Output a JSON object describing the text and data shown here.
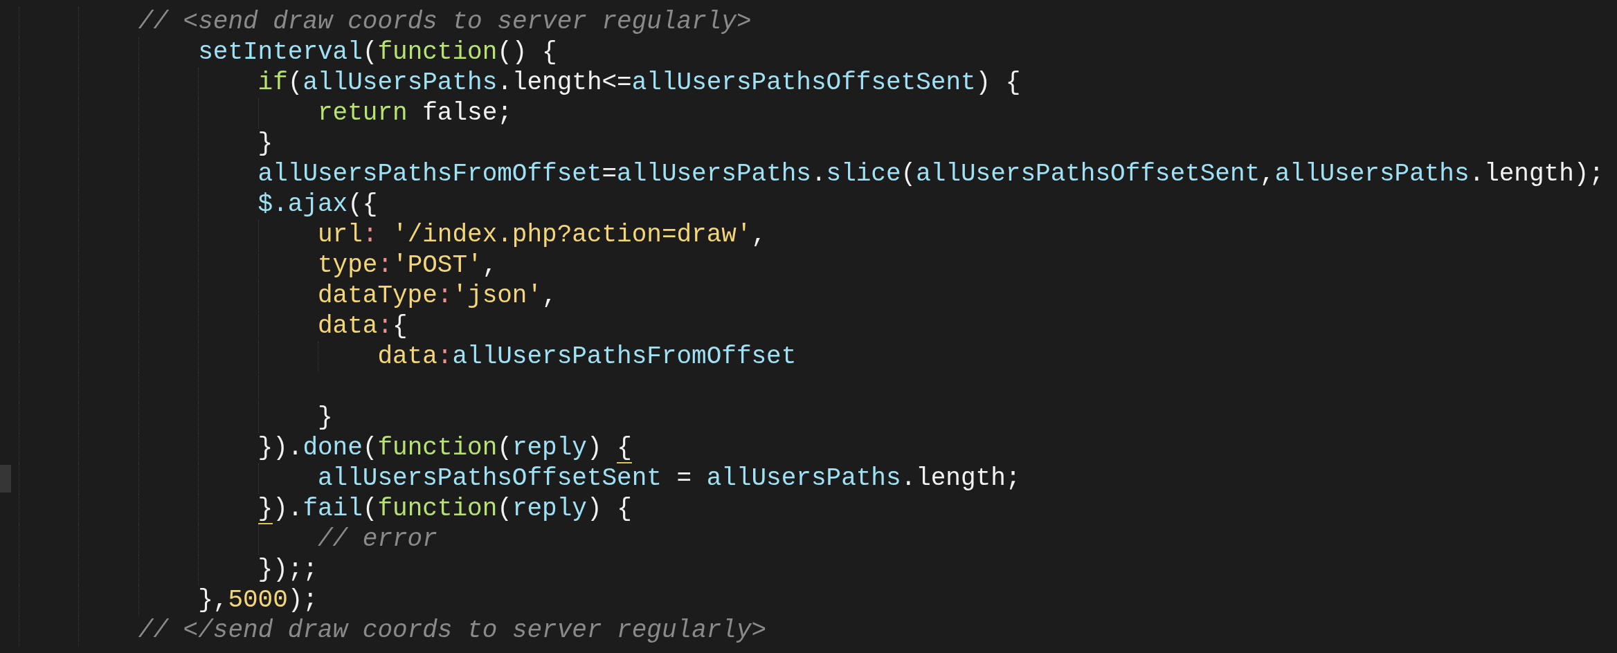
{
  "editor": {
    "lines": [
      {
        "current": false,
        "tokens": [
          {
            "kind": "comment",
            "text": "// <send draw coords to server regularly>",
            "bracket_match": false
          }
        ],
        "children": [
          {
            "current": false,
            "tokens": [
              {
                "kind": "name",
                "text": "setInterval",
                "bracket_match": false
              },
              {
                "kind": "plain",
                "text": "(",
                "bracket_match": false
              },
              {
                "kind": "keyword",
                "text": "function",
                "bracket_match": false
              },
              {
                "kind": "plain",
                "text": "() {",
                "bracket_match": false
              }
            ],
            "children": [
              {
                "current": false,
                "tokens": [
                  {
                    "kind": "keyword",
                    "text": "if",
                    "bracket_match": false
                  },
                  {
                    "kind": "plain",
                    "text": "(",
                    "bracket_match": false
                  },
                  {
                    "kind": "name",
                    "text": "allUsersPaths",
                    "bracket_match": false
                  },
                  {
                    "kind": "plain",
                    "text": ".length<=",
                    "bracket_match": false
                  },
                  {
                    "kind": "name",
                    "text": "allUsersPathsOffsetSent",
                    "bracket_match": false
                  },
                  {
                    "kind": "plain",
                    "text": ") {",
                    "bracket_match": false
                  }
                ],
                "children": [
                  {
                    "current": false,
                    "tokens": [
                      {
                        "kind": "keyword",
                        "text": "return",
                        "bracket_match": false
                      },
                      {
                        "kind": "plain",
                        "text": " false;",
                        "bracket_match": false
                      }
                    ]
                  }
                ]
              },
              {
                "current": false,
                "tokens": [
                  {
                    "kind": "plain",
                    "text": "}",
                    "bracket_match": false
                  }
                ]
              },
              {
                "current": false,
                "tokens": [
                  {
                    "kind": "name",
                    "text": "allUsersPathsFromOffset",
                    "bracket_match": false
                  },
                  {
                    "kind": "plain",
                    "text": "=",
                    "bracket_match": false
                  },
                  {
                    "kind": "name",
                    "text": "allUsersPaths",
                    "bracket_match": false
                  },
                  {
                    "kind": "plain",
                    "text": ".",
                    "bracket_match": false
                  },
                  {
                    "kind": "name",
                    "text": "slice",
                    "bracket_match": false
                  },
                  {
                    "kind": "plain",
                    "text": "(",
                    "bracket_match": false
                  },
                  {
                    "kind": "name",
                    "text": "allUsersPathsOffsetSent",
                    "bracket_match": false
                  },
                  {
                    "kind": "plain",
                    "text": ",",
                    "bracket_match": false
                  },
                  {
                    "kind": "name",
                    "text": "allUsersPaths",
                    "bracket_match": false
                  },
                  {
                    "kind": "plain",
                    "text": ".length);",
                    "bracket_match": false
                  }
                ]
              },
              {
                "current": false,
                "tokens": [
                  {
                    "kind": "name",
                    "text": "$.ajax",
                    "bracket_match": false
                  },
                  {
                    "kind": "plain",
                    "text": "({",
                    "bracket_match": false
                  }
                ],
                "children": [
                  {
                    "current": false,
                    "tokens": [
                      {
                        "kind": "key",
                        "text": "url",
                        "bracket_match": false
                      },
                      {
                        "kind": "colon",
                        "text": ":",
                        "bracket_match": false
                      },
                      {
                        "kind": "string",
                        "text": " '/index.php?action=draw'",
                        "bracket_match": false
                      },
                      {
                        "kind": "plain",
                        "text": ",",
                        "bracket_match": false
                      }
                    ]
                  },
                  {
                    "current": false,
                    "tokens": [
                      {
                        "kind": "key",
                        "text": "type",
                        "bracket_match": false
                      },
                      {
                        "kind": "colon",
                        "text": ":",
                        "bracket_match": false
                      },
                      {
                        "kind": "string",
                        "text": "'POST'",
                        "bracket_match": false
                      },
                      {
                        "kind": "plain",
                        "text": ",",
                        "bracket_match": false
                      }
                    ]
                  },
                  {
                    "current": false,
                    "tokens": [
                      {
                        "kind": "key",
                        "text": "dataType",
                        "bracket_match": false
                      },
                      {
                        "kind": "colon",
                        "text": ":",
                        "bracket_match": false
                      },
                      {
                        "kind": "string",
                        "text": "'json'",
                        "bracket_match": false
                      },
                      {
                        "kind": "plain",
                        "text": ",",
                        "bracket_match": false
                      }
                    ]
                  },
                  {
                    "current": false,
                    "tokens": [
                      {
                        "kind": "key",
                        "text": "data",
                        "bracket_match": false
                      },
                      {
                        "kind": "colon",
                        "text": ":",
                        "bracket_match": false
                      },
                      {
                        "kind": "plain",
                        "text": "{",
                        "bracket_match": false
                      }
                    ],
                    "children": [
                      {
                        "current": false,
                        "tokens": [
                          {
                            "kind": "key",
                            "text": "data",
                            "bracket_match": false
                          },
                          {
                            "kind": "colon",
                            "text": ":",
                            "bracket_match": false
                          },
                          {
                            "kind": "name",
                            "text": "allUsersPathsFromOffset",
                            "bracket_match": false
                          }
                        ]
                      }
                    ]
                  },
                  {
                    "current": false
                  },
                  {
                    "current": false,
                    "tokens": [
                      {
                        "kind": "plain",
                        "text": "}",
                        "bracket_match": false
                      }
                    ]
                  }
                ]
              },
              {
                "current": false,
                "tokens": [
                  {
                    "kind": "plain",
                    "text": "}).",
                    "bracket_match": false
                  },
                  {
                    "kind": "name",
                    "text": "done",
                    "bracket_match": false
                  },
                  {
                    "kind": "plain",
                    "text": "(",
                    "bracket_match": false
                  },
                  {
                    "kind": "keyword",
                    "text": "function",
                    "bracket_match": false
                  },
                  {
                    "kind": "plain",
                    "text": "(",
                    "bracket_match": false
                  },
                  {
                    "kind": "name",
                    "text": "reply",
                    "bracket_match": false
                  },
                  {
                    "kind": "plain",
                    "text": ") ",
                    "bracket_match": false
                  },
                  {
                    "kind": "plain",
                    "text": "{",
                    "bracket_match": true
                  }
                ],
                "children": [
                  {
                    "current": true,
                    "tokens": [
                      {
                        "kind": "name",
                        "text": "allUsersPathsOffsetSent",
                        "bracket_match": false
                      },
                      {
                        "kind": "plain",
                        "text": " = ",
                        "bracket_match": false
                      },
                      {
                        "kind": "name",
                        "text": "allUsersPaths",
                        "bracket_match": false
                      },
                      {
                        "kind": "plain",
                        "text": ".length;",
                        "bracket_match": false
                      }
                    ]
                  }
                ]
              },
              {
                "current": false,
                "tokens": [
                  {
                    "kind": "plain",
                    "text": "}",
                    "bracket_match": true
                  },
                  {
                    "kind": "plain",
                    "text": ").",
                    "bracket_match": false
                  },
                  {
                    "kind": "name",
                    "text": "fail",
                    "bracket_match": false
                  },
                  {
                    "kind": "plain",
                    "text": "(",
                    "bracket_match": false
                  },
                  {
                    "kind": "keyword",
                    "text": "function",
                    "bracket_match": false
                  },
                  {
                    "kind": "plain",
                    "text": "(",
                    "bracket_match": false
                  },
                  {
                    "kind": "name",
                    "text": "reply",
                    "bracket_match": false
                  },
                  {
                    "kind": "plain",
                    "text": ") {",
                    "bracket_match": false
                  }
                ],
                "children": [
                  {
                    "current": false,
                    "tokens": [
                      {
                        "kind": "comment",
                        "text": "// error",
                        "bracket_match": false
                      }
                    ]
                  }
                ]
              },
              {
                "current": false,
                "tokens": [
                  {
                    "kind": "plain",
                    "text": "});;",
                    "bracket_match": false
                  }
                ]
              }
            ]
          },
          {
            "current": false,
            "tokens": [
              {
                "kind": "plain",
                "text": "},",
                "bracket_match": false
              },
              {
                "kind": "number",
                "text": "5000",
                "bracket_match": false
              },
              {
                "kind": "plain",
                "text": ");",
                "bracket_match": false
              }
            ]
          }
        ]
      },
      {
        "current": false,
        "tokens": [
          {
            "kind": "comment",
            "text": "// </send draw coords to server regularly>",
            "bracket_match": false
          }
        ]
      }
    ]
  }
}
